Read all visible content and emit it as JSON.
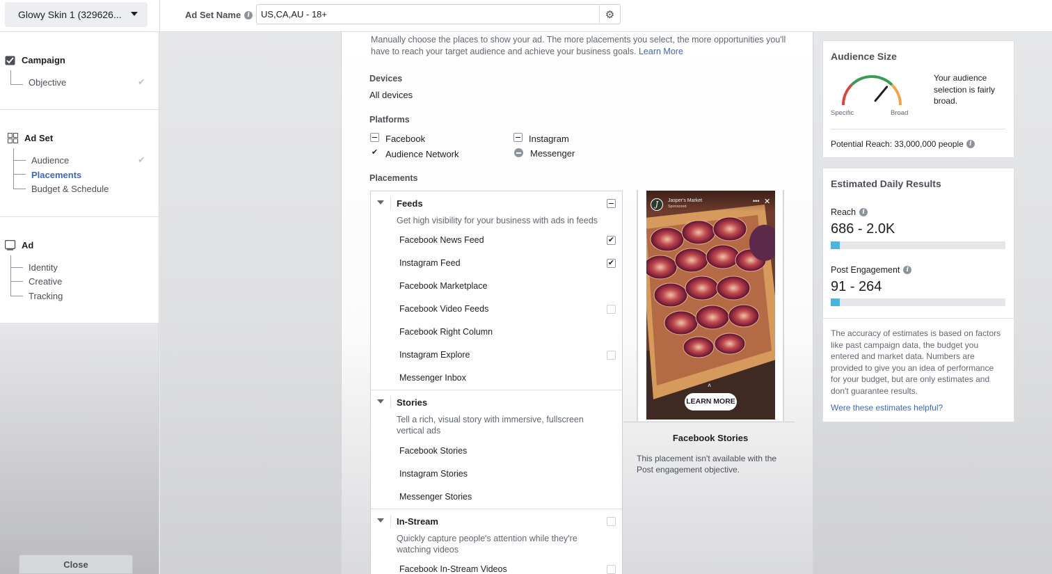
{
  "header": {
    "campaign_select": "Glowy Skin 1 (329626...",
    "adset_name_label": "Ad Set Name",
    "adset_name_value": "US,CA,AU - 18+"
  },
  "sidebar": {
    "campaign": {
      "label": "Campaign",
      "items": [
        "Objective"
      ]
    },
    "adset": {
      "label": "Ad Set",
      "items": [
        "Audience",
        "Placements",
        "Budget & Schedule"
      ],
      "active": "Placements"
    },
    "ad": {
      "label": "Ad",
      "items": [
        "Identity",
        "Creative",
        "Tracking"
      ]
    },
    "close_label": "Close"
  },
  "editor": {
    "description": "Manually choose the places to show your ad. The more placements you select, the more opportunities you'll have to reach your target audience and achieve your business goals.",
    "learn_more": "Learn More",
    "devices_label": "Devices",
    "devices_value": "All devices",
    "platforms_label": "Platforms",
    "platforms": {
      "facebook": "Facebook",
      "audience_network": "Audience Network",
      "instagram": "Instagram",
      "messenger": "Messenger"
    },
    "placements_label": "Placements",
    "groups": {
      "feeds": {
        "title": "Feeds",
        "desc": "Get high visibility for your business with ads in feeds",
        "items": [
          "Facebook News Feed",
          "Instagram Feed",
          "Facebook Marketplace",
          "Facebook Video Feeds",
          "Facebook Right Column",
          "Instagram Explore",
          "Messenger Inbox"
        ]
      },
      "stories": {
        "title": "Stories",
        "desc": "Tell a rich, visual story with immersive, fullscreen vertical ads",
        "items": [
          "Facebook Stories",
          "Instagram Stories",
          "Messenger Stories"
        ]
      },
      "instream": {
        "title": "In-Stream",
        "desc": "Quickly capture people's attention while they're watching videos",
        "items": [
          "Facebook In-Stream Videos"
        ]
      }
    },
    "preview": {
      "brand_name": "Jasper's Market",
      "brand_sub": "Sponsored",
      "cta": "LEARN MORE",
      "title": "Facebook Stories",
      "note": "This placement isn't available with the Post engagement objective."
    }
  },
  "audience_size": {
    "title": "Audience Size",
    "specific": "Specific",
    "broad": "Broad",
    "text": "Your audience selection is fairly broad.",
    "potential_reach": "Potential Reach: 33,000,000 people",
    "gauge_level": 0.72
  },
  "estimated": {
    "title": "Estimated Daily Results",
    "reach_label": "Reach",
    "reach_value": "686 - 2.0K",
    "reach_fill": 0.05,
    "engagement_label": "Post Engagement",
    "engagement_value": "91 - 264",
    "engagement_fill": 0.05,
    "note": "The accuracy of estimates is based on factors like past campaign data, the budget you entered and market data. Numbers are provided to give you an idea of performance for your budget, but are only estimates and don't guarantee results.",
    "helpful_link": "Were these estimates helpful?"
  },
  "colors": {
    "accent": "#4267b2",
    "bar": "#4ab5e3"
  }
}
